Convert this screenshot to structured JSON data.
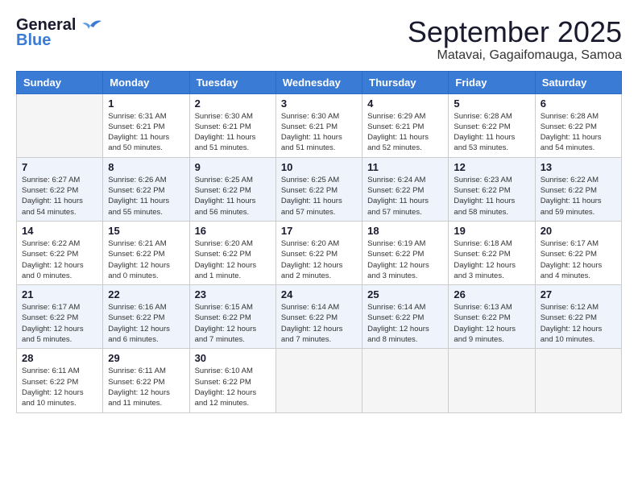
{
  "header": {
    "logo_general": "General",
    "logo_blue": "Blue",
    "month_title": "September 2025",
    "location": "Matavai, Gagaifomauga, Samoa"
  },
  "days_of_week": [
    "Sunday",
    "Monday",
    "Tuesday",
    "Wednesday",
    "Thursday",
    "Friday",
    "Saturday"
  ],
  "weeks": [
    [
      {
        "day": "",
        "info": ""
      },
      {
        "day": "1",
        "info": "Sunrise: 6:31 AM\nSunset: 6:21 PM\nDaylight: 11 hours\nand 50 minutes."
      },
      {
        "day": "2",
        "info": "Sunrise: 6:30 AM\nSunset: 6:21 PM\nDaylight: 11 hours\nand 51 minutes."
      },
      {
        "day": "3",
        "info": "Sunrise: 6:30 AM\nSunset: 6:21 PM\nDaylight: 11 hours\nand 51 minutes."
      },
      {
        "day": "4",
        "info": "Sunrise: 6:29 AM\nSunset: 6:21 PM\nDaylight: 11 hours\nand 52 minutes."
      },
      {
        "day": "5",
        "info": "Sunrise: 6:28 AM\nSunset: 6:22 PM\nDaylight: 11 hours\nand 53 minutes."
      },
      {
        "day": "6",
        "info": "Sunrise: 6:28 AM\nSunset: 6:22 PM\nDaylight: 11 hours\nand 54 minutes."
      }
    ],
    [
      {
        "day": "7",
        "info": "Sunrise: 6:27 AM\nSunset: 6:22 PM\nDaylight: 11 hours\nand 54 minutes."
      },
      {
        "day": "8",
        "info": "Sunrise: 6:26 AM\nSunset: 6:22 PM\nDaylight: 11 hours\nand 55 minutes."
      },
      {
        "day": "9",
        "info": "Sunrise: 6:25 AM\nSunset: 6:22 PM\nDaylight: 11 hours\nand 56 minutes."
      },
      {
        "day": "10",
        "info": "Sunrise: 6:25 AM\nSunset: 6:22 PM\nDaylight: 11 hours\nand 57 minutes."
      },
      {
        "day": "11",
        "info": "Sunrise: 6:24 AM\nSunset: 6:22 PM\nDaylight: 11 hours\nand 57 minutes."
      },
      {
        "day": "12",
        "info": "Sunrise: 6:23 AM\nSunset: 6:22 PM\nDaylight: 11 hours\nand 58 minutes."
      },
      {
        "day": "13",
        "info": "Sunrise: 6:22 AM\nSunset: 6:22 PM\nDaylight: 11 hours\nand 59 minutes."
      }
    ],
    [
      {
        "day": "14",
        "info": "Sunrise: 6:22 AM\nSunset: 6:22 PM\nDaylight: 12 hours\nand 0 minutes."
      },
      {
        "day": "15",
        "info": "Sunrise: 6:21 AM\nSunset: 6:22 PM\nDaylight: 12 hours\nand 0 minutes."
      },
      {
        "day": "16",
        "info": "Sunrise: 6:20 AM\nSunset: 6:22 PM\nDaylight: 12 hours\nand 1 minute."
      },
      {
        "day": "17",
        "info": "Sunrise: 6:20 AM\nSunset: 6:22 PM\nDaylight: 12 hours\nand 2 minutes."
      },
      {
        "day": "18",
        "info": "Sunrise: 6:19 AM\nSunset: 6:22 PM\nDaylight: 12 hours\nand 3 minutes."
      },
      {
        "day": "19",
        "info": "Sunrise: 6:18 AM\nSunset: 6:22 PM\nDaylight: 12 hours\nand 3 minutes."
      },
      {
        "day": "20",
        "info": "Sunrise: 6:17 AM\nSunset: 6:22 PM\nDaylight: 12 hours\nand 4 minutes."
      }
    ],
    [
      {
        "day": "21",
        "info": "Sunrise: 6:17 AM\nSunset: 6:22 PM\nDaylight: 12 hours\nand 5 minutes."
      },
      {
        "day": "22",
        "info": "Sunrise: 6:16 AM\nSunset: 6:22 PM\nDaylight: 12 hours\nand 6 minutes."
      },
      {
        "day": "23",
        "info": "Sunrise: 6:15 AM\nSunset: 6:22 PM\nDaylight: 12 hours\nand 7 minutes."
      },
      {
        "day": "24",
        "info": "Sunrise: 6:14 AM\nSunset: 6:22 PM\nDaylight: 12 hours\nand 7 minutes."
      },
      {
        "day": "25",
        "info": "Sunrise: 6:14 AM\nSunset: 6:22 PM\nDaylight: 12 hours\nand 8 minutes."
      },
      {
        "day": "26",
        "info": "Sunrise: 6:13 AM\nSunset: 6:22 PM\nDaylight: 12 hours\nand 9 minutes."
      },
      {
        "day": "27",
        "info": "Sunrise: 6:12 AM\nSunset: 6:22 PM\nDaylight: 12 hours\nand 10 minutes."
      }
    ],
    [
      {
        "day": "28",
        "info": "Sunrise: 6:11 AM\nSunset: 6:22 PM\nDaylight: 12 hours\nand 10 minutes."
      },
      {
        "day": "29",
        "info": "Sunrise: 6:11 AM\nSunset: 6:22 PM\nDaylight: 12 hours\nand 11 minutes."
      },
      {
        "day": "30",
        "info": "Sunrise: 6:10 AM\nSunset: 6:22 PM\nDaylight: 12 hours\nand 12 minutes."
      },
      {
        "day": "",
        "info": ""
      },
      {
        "day": "",
        "info": ""
      },
      {
        "day": "",
        "info": ""
      },
      {
        "day": "",
        "info": ""
      }
    ]
  ]
}
